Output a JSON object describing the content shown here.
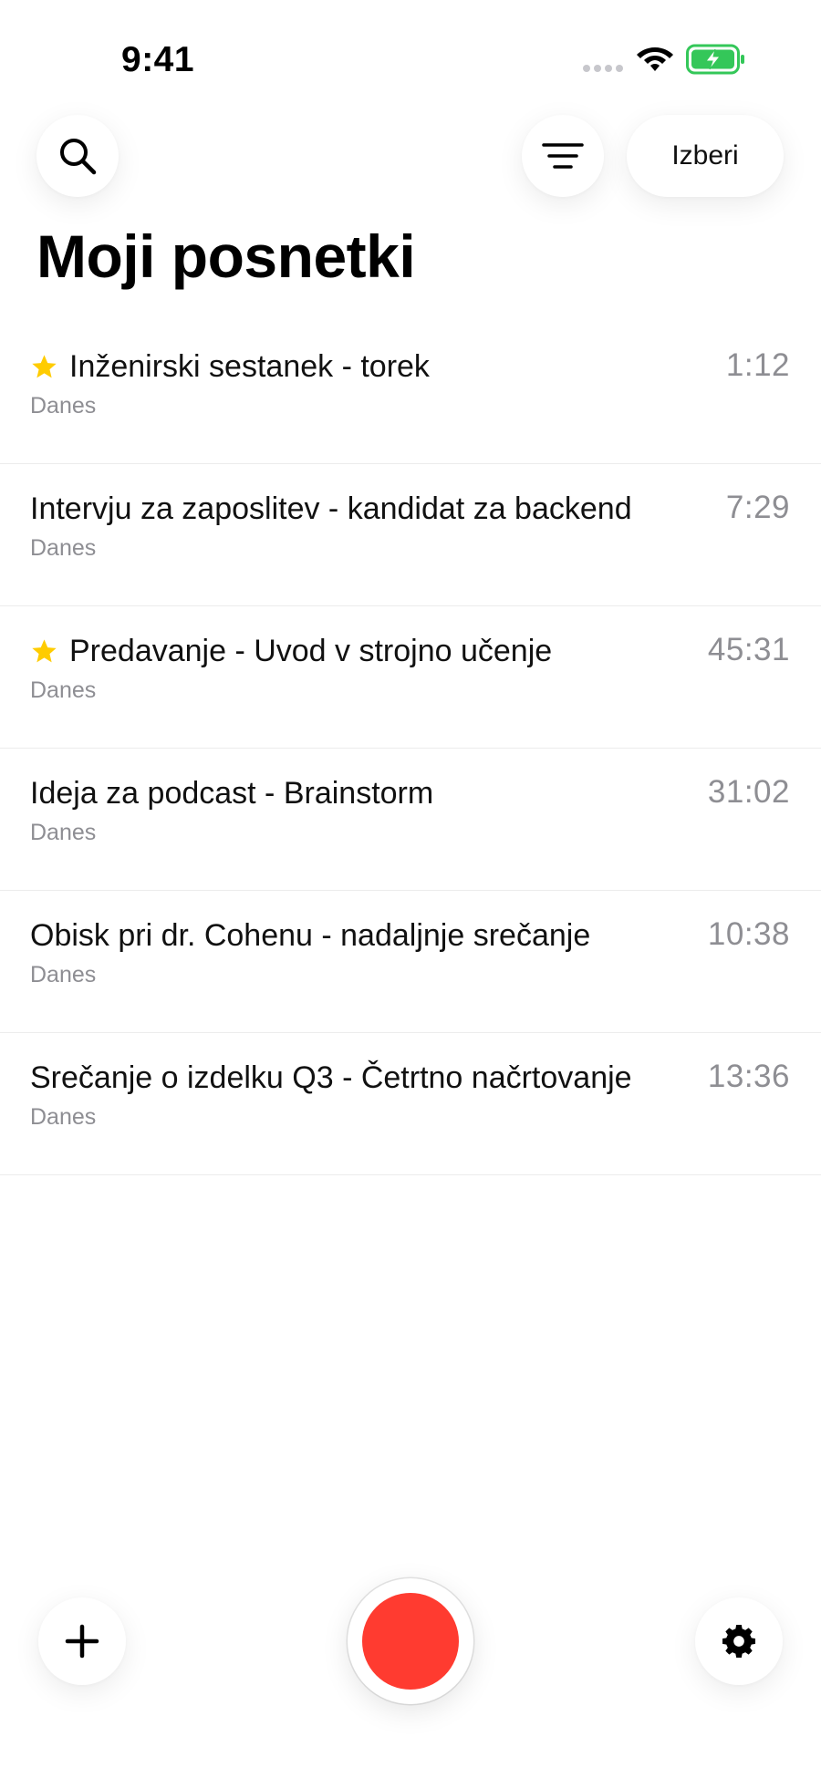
{
  "status_bar": {
    "time": "9:41",
    "battery_color": "#34c759"
  },
  "header": {
    "search_icon": "search-icon",
    "filter_icon": "filter-lines-icon",
    "select_label": "Izberi"
  },
  "page_title": "Moji posnetki",
  "recordings": [
    {
      "title": "Inženirski sestanek - torek",
      "date": "Danes",
      "duration": "1:12",
      "starred": true
    },
    {
      "title": "Intervju za zaposlitev - kandidat za backend",
      "date": "Danes",
      "duration": "7:29",
      "starred": false
    },
    {
      "title": "Predavanje - Uvod v strojno učenje",
      "date": "Danes",
      "duration": "45:31",
      "starred": true
    },
    {
      "title": "Ideja za podcast - Brainstorm",
      "date": "Danes",
      "duration": "31:02",
      "starred": false
    },
    {
      "title": "Obisk pri dr. Cohenu - nadaljnje srečanje",
      "date": "Danes",
      "duration": "10:38",
      "starred": false
    },
    {
      "title": "Srečanje o izdelku Q3 - Četrtno načrtovanje",
      "date": "Danes",
      "duration": "13:36",
      "starred": false
    }
  ],
  "bottom_bar": {
    "add_icon": "plus-icon",
    "record_icon": "record-icon",
    "settings_icon": "gear-icon",
    "record_color": "#ff3b30"
  },
  "colors": {
    "star": "#ffcc00",
    "secondary_text": "#8e8e93"
  }
}
